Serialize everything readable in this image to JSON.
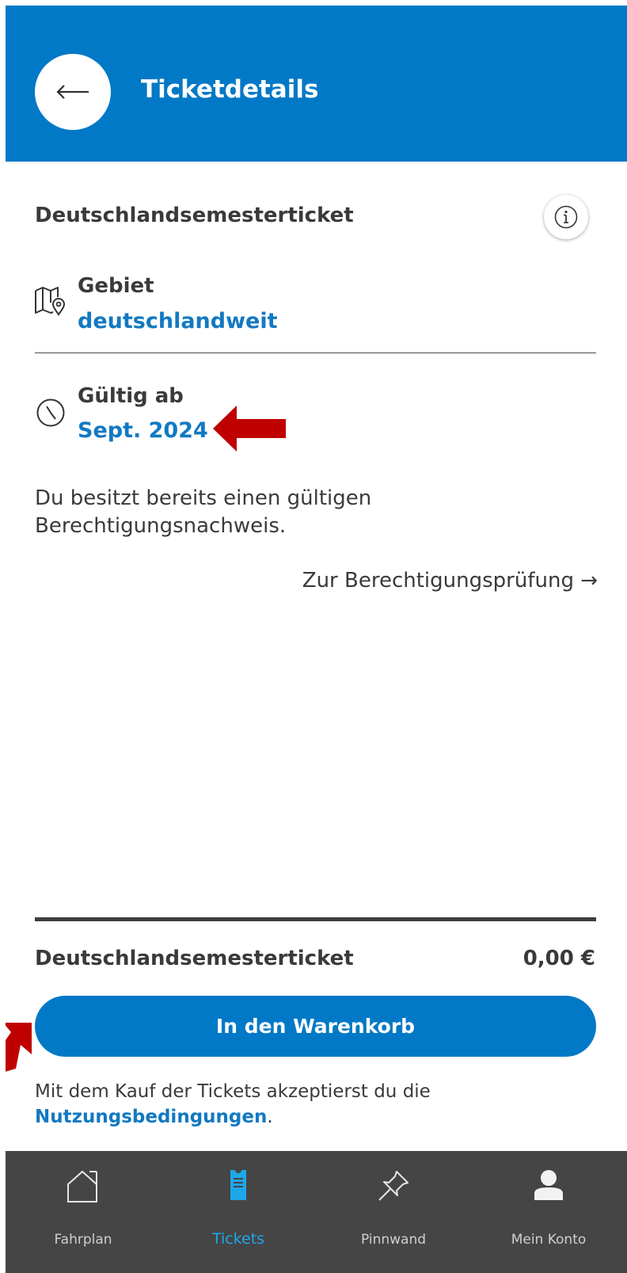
{
  "header": {
    "title": "Ticketdetails"
  },
  "ticket": {
    "name": "Deutschlandsemesterticket",
    "area_label": "Gebiet",
    "area_value": "deutschlandweit",
    "valid_label": "Gültig ab",
    "valid_value": "Sept. 2024",
    "note": "Du besitzt bereits einen gültigen Berechtigungsnachweis.",
    "check_link": "Zur Berechtigungsprüfung →"
  },
  "summary": {
    "name": "Deutschlandsemesterticket",
    "price": "0,00 €",
    "cart_button": "In den Warenkorb",
    "terms_text": "Mit dem Kauf der Tickets akzeptierst du die",
    "terms_link": "Nutzungsbedingungen",
    "terms_end": "."
  },
  "tabs": [
    {
      "label": "Fahrplan",
      "icon": "house-icon",
      "active": false
    },
    {
      "label": "Tickets",
      "icon": "ticket-icon",
      "active": true
    },
    {
      "label": "Pinnwand",
      "icon": "pin-icon",
      "active": false
    },
    {
      "label": "Mein Konto",
      "icon": "person-icon",
      "active": false
    }
  ],
  "colors": {
    "brand": "#0179c6",
    "link": "#1279c2",
    "annotation_arrow": "#c00000",
    "tabbar": "#454545",
    "tab_active": "#1ea7e8"
  }
}
